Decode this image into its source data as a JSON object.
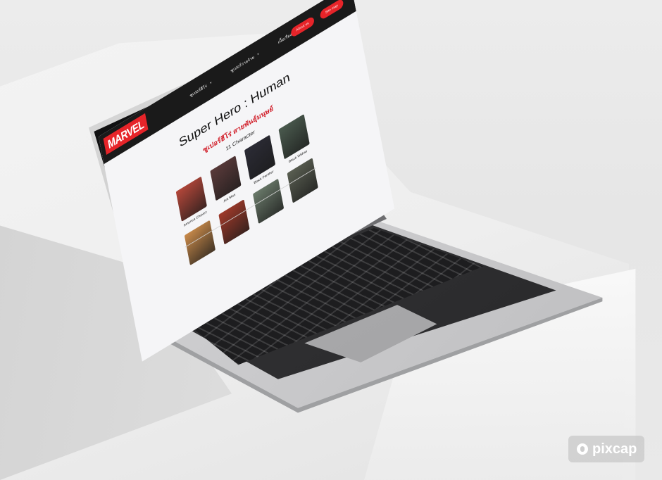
{
  "nav": {
    "logo": "MARVEL",
    "menu": [
      {
        "label": "ซูเปอร์ฮีโร่"
      },
      {
        "label": "ซูเปอร์วายร้าย"
      },
      {
        "label": "เนื้อเรื่อง"
      }
    ],
    "about_label": "About us",
    "sitemap_label": "Site map"
  },
  "main": {
    "title": "Super Hero : Human",
    "subtitle": "ซูเปอร์ฮีโร่ สายพันธุ์มนุษย์",
    "count": "11 Character",
    "characters": [
      {
        "name": "America Chavez",
        "color": "#b5473a"
      },
      {
        "name": "Ant Man",
        "color": "#5a3a3a"
      },
      {
        "name": "Black Panther",
        "color": "#2b2b35"
      },
      {
        "name": "Black Widow",
        "color": "#4a5a4e"
      },
      {
        "name": "",
        "color": "#c98a4a"
      },
      {
        "name": "",
        "color": "#a03a2a"
      },
      {
        "name": "",
        "color": "#6a7a6a"
      },
      {
        "name": "",
        "color": "#5a5f52"
      }
    ]
  },
  "watermark": {
    "text": "pixcap",
    "icon": "pixcap-logo-icon"
  }
}
